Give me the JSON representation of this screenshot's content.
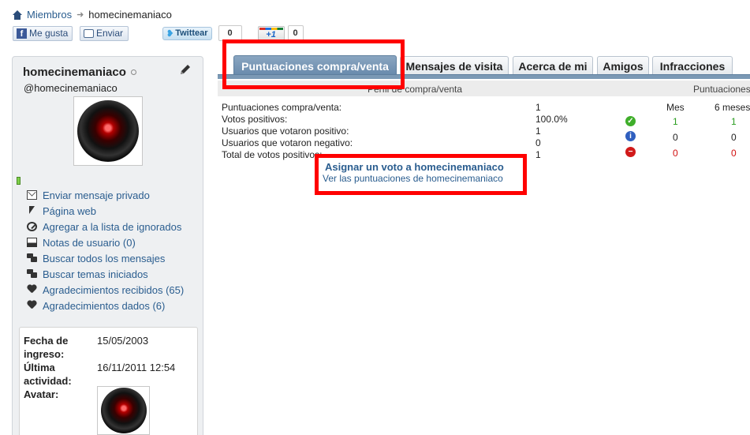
{
  "breadcrumb": {
    "home_label": "Miembros",
    "current": "homecinemaniaco"
  },
  "social": {
    "like_label": "Me gusta",
    "send_label": "Enviar",
    "tweet_label": "Twittear",
    "tweet_count": "0",
    "plusone_label": "+1",
    "plusone_count": "0"
  },
  "profile": {
    "username": "homecinemaniaco",
    "handle": "@homecinemaniaco",
    "actions": [
      {
        "label": "Enviar mensaje privado",
        "icon": "mail-icon"
      },
      {
        "label": "Página web",
        "icon": "cursor-icon"
      },
      {
        "label": "Agregar a la lista de ignorados",
        "icon": "block-icon"
      },
      {
        "label": "Notas de usuario (0)",
        "icon": "notes-icon"
      },
      {
        "label": "Buscar todos los mensajes",
        "icon": "chat-icon"
      },
      {
        "label": "Buscar temas iniciados",
        "icon": "chat-icon"
      },
      {
        "label": "Agradecimientos recibidos (65)",
        "icon": "heart-icon"
      },
      {
        "label": "Agradecimientos dados (6)",
        "icon": "heart-icon"
      }
    ],
    "info": {
      "joined_label": "Fecha de ingreso:",
      "joined_value": "15/05/2003",
      "last_label": "Última actividad:",
      "last_value": "16/11/2011 12:54",
      "avatar_label": "Avatar:"
    }
  },
  "tabs": [
    {
      "label": "Puntuaciones compra/venta",
      "active": true
    },
    {
      "label": "Mensajes de visita",
      "active": false
    },
    {
      "label": "Acerca de mi",
      "active": false
    },
    {
      "label": "Amigos",
      "active": false
    },
    {
      "label": "Infracciones",
      "active": false
    }
  ],
  "feedback": {
    "header_left": "Perfil de compra/venta",
    "header_right": "Puntuaciones",
    "col_month": "Mes",
    "col_six_months": "6 meses",
    "rows": [
      {
        "label": "Puntuaciones compra/venta:",
        "value": "1"
      },
      {
        "label": "Votos positivos:",
        "value": "100.0%",
        "month": "1",
        "six": "1"
      },
      {
        "label": "Usuarios que votaron positivo:",
        "value": "1",
        "month": "0",
        "six": "0"
      },
      {
        "label": "Usuarios que votaron negativo:",
        "value": "0",
        "month": "0",
        "six": "0"
      },
      {
        "label": "Total de votos positivos:",
        "value": "1"
      }
    ],
    "assign_link": "Asignar un voto a homecinemaniaco",
    "view_link": "Ver las puntuaciones de homecinemaniaco"
  },
  "colors": {
    "link": "#2a5d8f",
    "tab_active": "#6789ab",
    "annotation": "#ff0000",
    "positive": "#2a9d1f",
    "negative": "#d10f0f"
  }
}
